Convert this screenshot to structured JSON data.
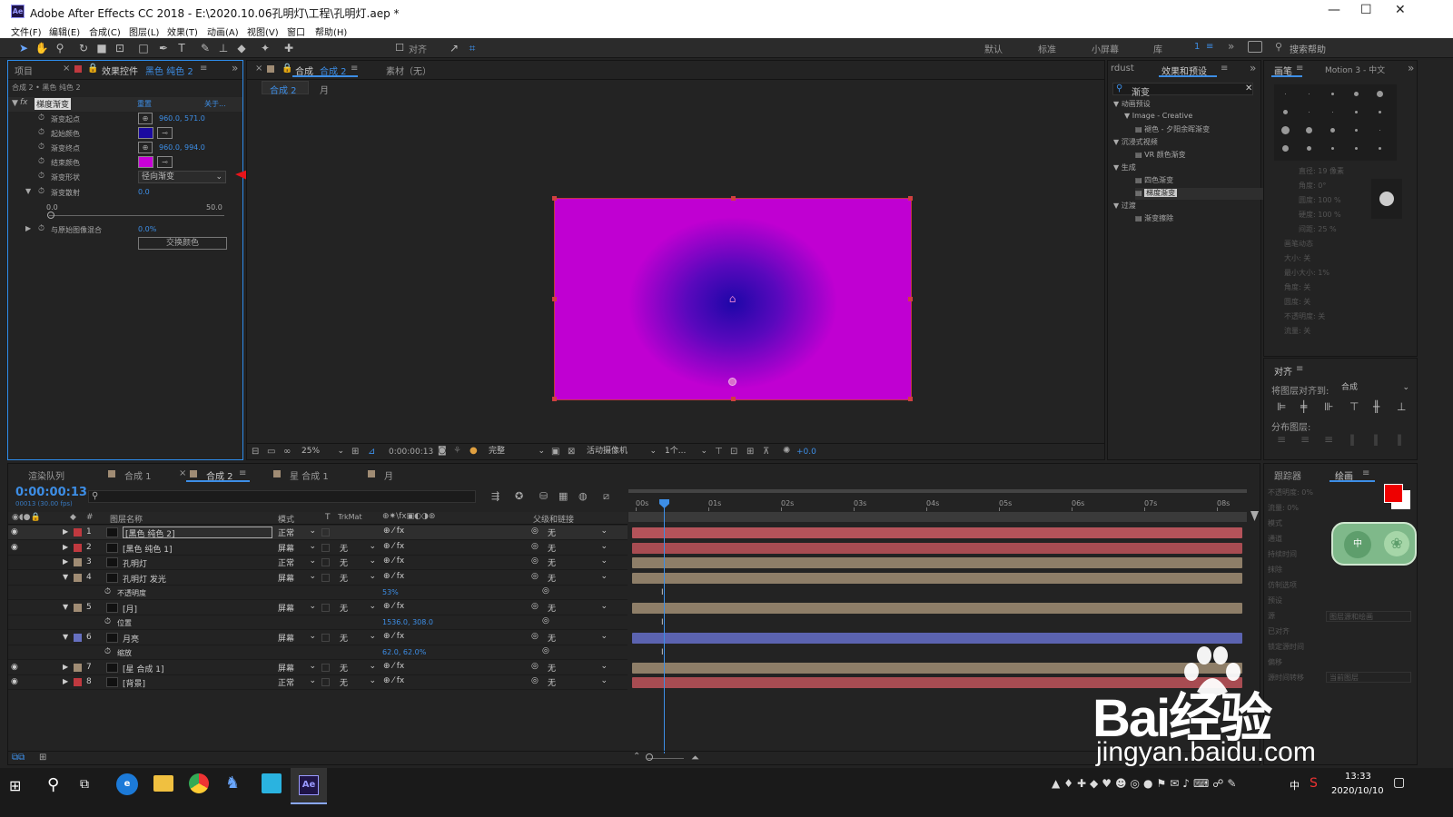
{
  "app": {
    "title": "Adobe After Effects CC 2018 - E:\\2020.10.06孔明灯\\工程\\孔明灯.aep *",
    "logo": "Ae"
  },
  "window_controls": {
    "minimize": "—",
    "maximize": "☐",
    "close": "✕"
  },
  "menu": [
    "文件(F)",
    "编辑(E)",
    "合成(C)",
    "图层(L)",
    "效果(T)",
    "动画(A)",
    "视图(V)",
    "窗口",
    "帮助(H)"
  ],
  "toolbar": {
    "align_label": "对齐",
    "workspaces": [
      "默认",
      "标准",
      "小屏幕",
      "库"
    ],
    "ws_num": "1",
    "search_placeholder": "搜索帮助"
  },
  "left_panel": {
    "tab_project": "项目",
    "tab_effects": "效果控件",
    "tab_effects_layer": "黑色 纯色 2",
    "path": "合成 2 • 黑色 纯色 2",
    "effect_name": "梯度渐变",
    "reset": "重置",
    "about": "关于...",
    "props": [
      {
        "label": "渐变起点",
        "value": "960.0, 571.0"
      },
      {
        "label": "起始颜色",
        "value": ""
      },
      {
        "label": "渐变终点",
        "value": "960.0, 994.0"
      },
      {
        "label": "结束颜色",
        "value": ""
      },
      {
        "label": "渐变形状",
        "value": "径向渐变"
      },
      {
        "label": "渐变散射",
        "value": "0.0"
      },
      {
        "label": "与原始图像混合",
        "value": "0.0%"
      }
    ],
    "scatter_min": "0.0",
    "scatter_max": "50.0",
    "swap_button": "交换颜色",
    "start_color": "#1a0aa0",
    "end_color": "#c800d8"
  },
  "comp_panel": {
    "tab_comp": "合成",
    "tab_comp_name": "合成 2",
    "tab_material": "素材（无）",
    "breadcrumb": [
      "合成 2",
      "月"
    ],
    "zoom": "25%",
    "timecode": "0:00:00:13",
    "quality": "完整",
    "camera": "活动摄像机",
    "views": "1个...",
    "exposure": "+0.0",
    "canvas_start_color": "#1e07a8",
    "canvas_end_color": "#c000d2"
  },
  "effects_panel": {
    "tab_left": "rdust",
    "tab": "效果和预设",
    "search": "渐变",
    "tree": [
      {
        "label": "动画预设",
        "level": 0
      },
      {
        "label": "Image - Creative",
        "level": 1
      },
      {
        "label": "褪色 - 夕阳余晖渐变",
        "level": 2
      },
      {
        "label": "沉浸式视频",
        "level": 0
      },
      {
        "label": "VR 颜色渐变",
        "level": 2
      },
      {
        "label": "生成",
        "level": 0
      },
      {
        "label": "四色渐变",
        "level": 2
      },
      {
        "label": "梯度渐变",
        "level": 2
      },
      {
        "label": "过渡",
        "level": 0
      },
      {
        "label": "渐变擦除",
        "level": 2
      }
    ]
  },
  "brush_panel": {
    "tab": "画笔",
    "tab2": "Motion 3 - 中文",
    "labels": [
      "直径: 19 像素",
      "角度: 0°",
      "圆度: 100 %",
      "硬度: 100 %",
      "间距: 25 %",
      "画笔动态",
      "大小: 关",
      "最小大小: 1%",
      "角度: 关",
      "圆度: 关",
      "不透明度: 关",
      "流量: 关"
    ]
  },
  "align_panel": {
    "title": "对齐",
    "align_to_label": "将图层对齐到:",
    "align_to": "合成",
    "distribute": "分布图层:"
  },
  "timeline": {
    "tabs": [
      "渲染队列",
      "合成 1",
      "合成 2",
      "星 合成 1",
      "月"
    ],
    "timecode": "0:00:00:13",
    "fps": "00013 (30.00 fps)",
    "headers": {
      "name": "图层名称",
      "mode": "模式",
      "t": "T",
      "trkmat": "TrkMat",
      "parent": "父级和链接"
    },
    "ruler": [
      "00s",
      "01s",
      "02s",
      "03s",
      "04s",
      "05s",
      "06s",
      "07s",
      "08s"
    ],
    "layers": [
      {
        "num": "1",
        "name": "[黑色 纯色 2]",
        "mode": "正常",
        "trk": "",
        "parent": "无",
        "color": "#c0393f",
        "bar": "#b5535a",
        "selected": true
      },
      {
        "num": "2",
        "name": "[黑色 纯色 1]",
        "mode": "屏幕",
        "trk": "无",
        "parent": "无",
        "color": "#c0393f",
        "bar": "#a84c52"
      },
      {
        "num": "3",
        "name": "孔明灯",
        "mode": "正常",
        "trk": "无",
        "parent": "无",
        "color": "#a08c74",
        "bar": "#8e7e68"
      },
      {
        "num": "4",
        "name": "孔明灯 发光",
        "mode": "屏幕",
        "trk": "无",
        "parent": "无",
        "color": "#a08c74",
        "bar": "#8e7e68"
      },
      {
        "sub": true,
        "name": "不透明度",
        "value": "53%"
      },
      {
        "num": "5",
        "name": "[月]",
        "mode": "屏幕",
        "trk": "无",
        "parent": "无",
        "color": "#a08c74",
        "bar": "#8e7e68"
      },
      {
        "sub": true,
        "name": "位置",
        "value": "1536.0, 308.0"
      },
      {
        "num": "6",
        "name": "月亮",
        "mode": "屏幕",
        "trk": "无",
        "parent": "无",
        "color": "#6670c0",
        "bar": "#5b63b0"
      },
      {
        "sub": true,
        "name": "缩放",
        "value": "62.0, 62.0%"
      },
      {
        "num": "7",
        "name": "[星 合成 1]",
        "mode": "屏幕",
        "trk": "无",
        "parent": "无",
        "color": "#a08c74",
        "bar": "#8e7e68"
      },
      {
        "num": "8",
        "name": "[背景]",
        "mode": "正常",
        "trk": "无",
        "parent": "无",
        "color": "#c0393f",
        "bar": "#a84c52"
      }
    ]
  },
  "right_bottom": {
    "tab_tracker": "跟踪器",
    "tab_paint": "绘画",
    "labels": [
      "不透明度: 0%",
      "流量: 0%",
      "模式",
      "通道",
      "持续时间",
      "抹除",
      "仿制选项",
      "预设",
      "源",
      "已对齐",
      "锁定源时间",
      "偏移",
      "源时间转移"
    ],
    "source_layer": "当前图层",
    "erase_opt": "图层源和绘画"
  },
  "watermark": {
    "brand": "Bai经验",
    "url": "jingyan.baidu.com"
  },
  "ime": {
    "text": "中"
  },
  "taskbar": {
    "time": "13:33",
    "date": "2020/10/10",
    "ime": "中"
  }
}
